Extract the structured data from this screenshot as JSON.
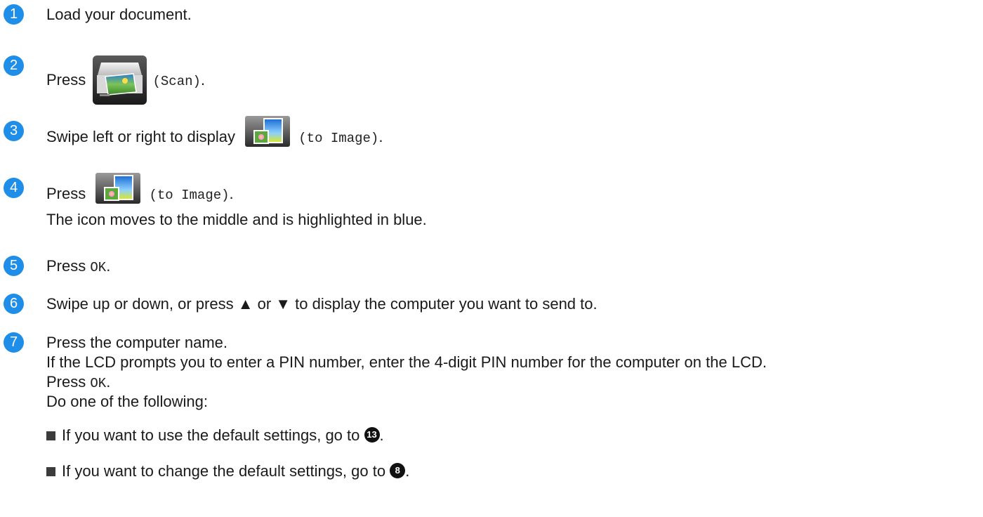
{
  "steps": [
    {
      "num": "1",
      "text": "Load your document."
    },
    {
      "num": "2",
      "pre": "Press",
      "code": "(Scan)",
      "post": "."
    },
    {
      "num": "3",
      "pre": "Swipe left or right to display",
      "code": "(to Image)",
      "post": "."
    },
    {
      "num": "4",
      "pre": "Press",
      "code": "(to Image)",
      "post": ".",
      "line2": "The icon moves to the middle and is highlighted in blue."
    },
    {
      "num": "5",
      "pre": "Press",
      "code": "OK",
      "post": "."
    },
    {
      "num": "6",
      "text": "Swipe up or down, or press ▲ or ▼ to display the computer you want to send to."
    },
    {
      "num": "7",
      "line1": "Press the computer name.",
      "line2": "If the LCD prompts you to enter a PIN number, enter the 4-digit PIN number for the computer on the LCD.",
      "line3_pre": "Press",
      "line3_code": "OK",
      "line3_post": ".",
      "line4": "Do one of the following:",
      "bullets": [
        {
          "text": "If you want to use the default settings, go to",
          "ref": "13",
          "post": "."
        },
        {
          "text": "If you want to change the default settings, go to",
          "ref": "8",
          "post": "."
        }
      ]
    }
  ],
  "icons": {
    "scan": "scan-icon",
    "to_image": "to-image-icon"
  },
  "colors": {
    "step_badge": "#1f8ee8",
    "text": "#1a1a1a"
  }
}
